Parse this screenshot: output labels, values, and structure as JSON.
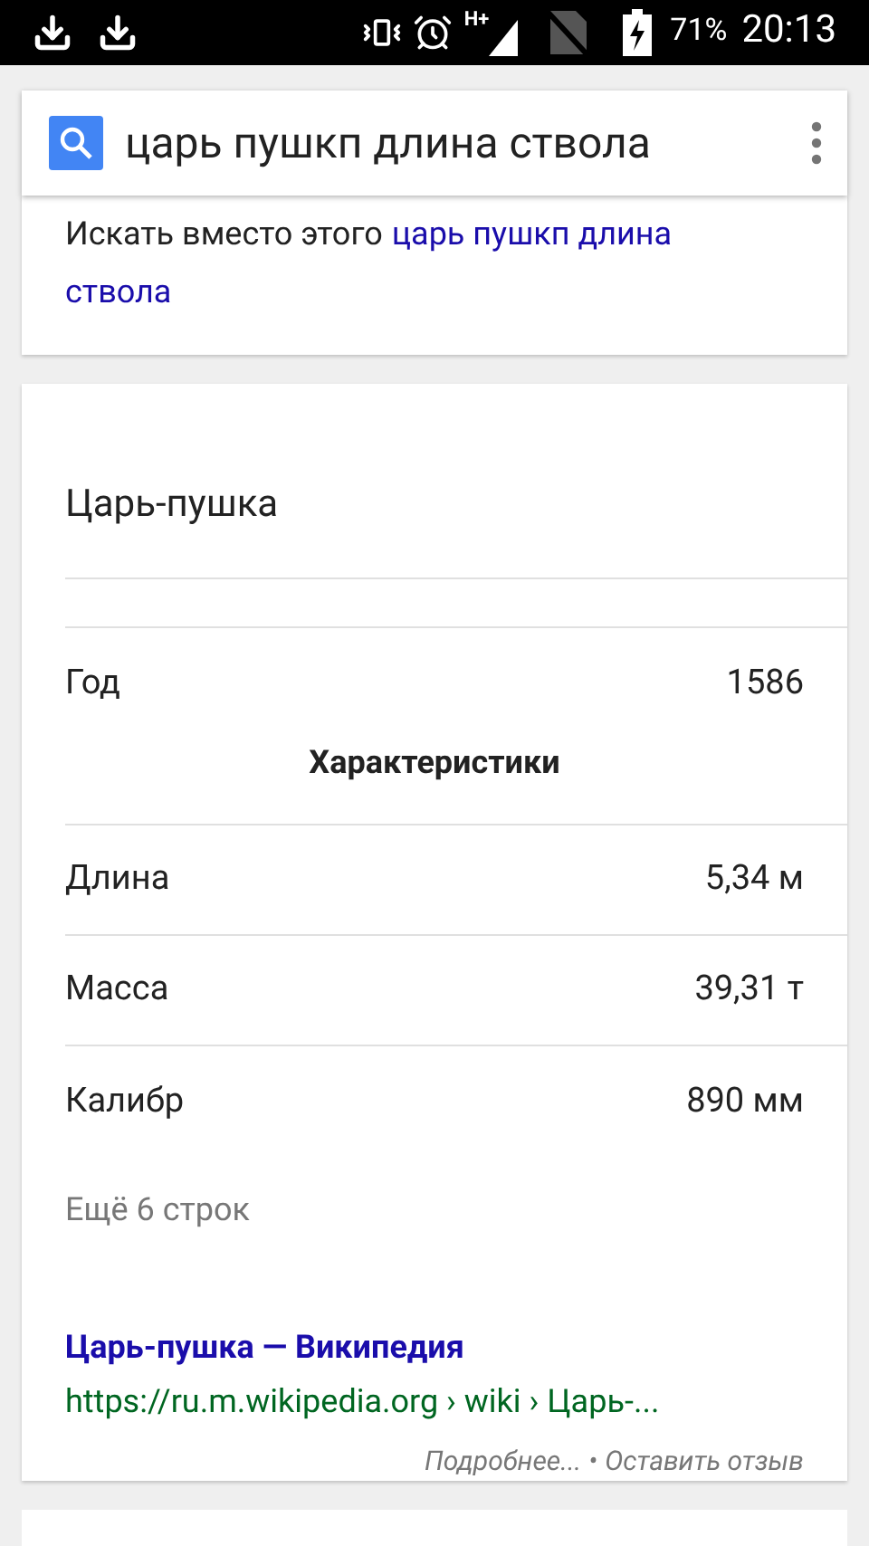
{
  "status_bar": {
    "network": "H+",
    "battery": "71%",
    "time": "20:13"
  },
  "search": {
    "value": "царь пушкп длина ствола"
  },
  "suggestion": {
    "prefix": "Искать вместо этого",
    "link_lines": [
      "царь пушкп длина",
      "ствола"
    ]
  },
  "infobox": {
    "title": "Царь-пушка",
    "rows": [
      {
        "kind": "pair",
        "label": "Год",
        "value": "1586"
      },
      {
        "kind": "heading",
        "label": "Характеристики"
      },
      {
        "kind": "pair",
        "label": "Длина",
        "value": "5,34 м"
      },
      {
        "kind": "pair",
        "label": "Масса",
        "value": "39,31 т"
      },
      {
        "kind": "pair",
        "label": "Калибр",
        "value": "890 мм"
      }
    ],
    "more": "Ещё 6 строк",
    "result_title": "Царь-пушка — Википедия",
    "result_url": "https://ru.m.wikipedia.org › wiki › Царь-...",
    "footer_links": [
      "Подробнее...",
      "Оставить отзыв"
    ],
    "footer_separator": "•"
  }
}
